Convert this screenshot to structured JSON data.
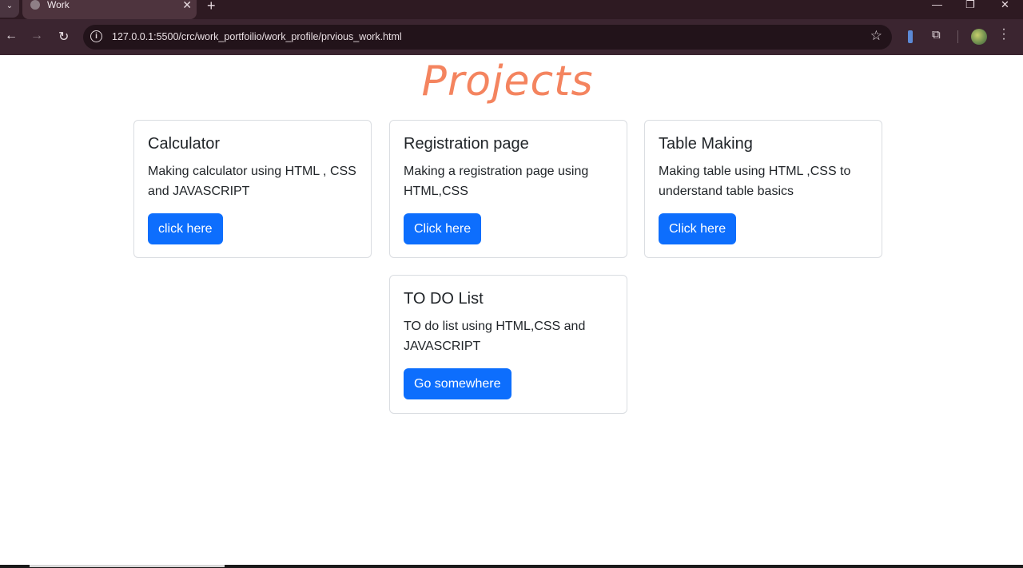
{
  "browser": {
    "tab_title": "Work",
    "url": "127.0.0.1:5500/crc/work_portfoilio/work_profile/prvious_work.html",
    "new_tab_glyph": "+",
    "close_tab_glyph": "✕",
    "window_controls": {
      "minimize": "—",
      "restore": "❐",
      "close": "✕"
    },
    "nav": {
      "back": "←",
      "forward": "→",
      "reload": "↻"
    },
    "icons": {
      "tab_menu": "chevron-down-icon",
      "info": "info-icon",
      "bookmark": "star-icon",
      "extensions": "puzzle-icon",
      "menu": "kebab-menu-icon"
    }
  },
  "page": {
    "title": "Projects",
    "title_color": "#f4845f",
    "accent_color": "#0d6efd"
  },
  "cards": [
    {
      "title": "Calculator",
      "text": "Making calculator using HTML , CSS and JAVASCRIPT",
      "button": "click here"
    },
    {
      "title": "Registration page",
      "text": "Making a registration page using HTML,CSS",
      "button": "Click here"
    },
    {
      "title": "Table Making",
      "text": "Making table using HTML ,CSS to understand table basics",
      "button": "Click here"
    },
    {
      "title": "TO DO List",
      "text": "TO do list using HTML,CSS and JAVASCRIPT",
      "button": "Go somewhere"
    }
  ]
}
